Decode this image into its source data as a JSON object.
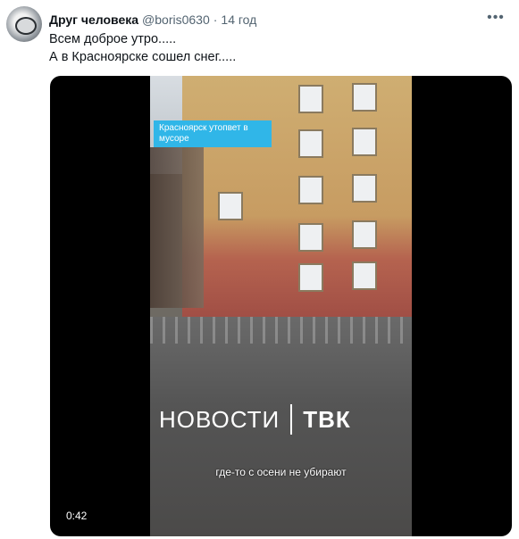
{
  "tweet": {
    "author_name": "Друг человека",
    "handle": "@boris0630",
    "separator": "·",
    "time": "14 год",
    "more_icon": "more-icon",
    "text_lines": [
      "Всем доброе утро.....",
      "А в Красноярске сошел снег....."
    ]
  },
  "video": {
    "caption_box": "Красноярск утопвет в мусоре",
    "brand_left": "НОВОСТИ",
    "brand_right": "ТВК",
    "subtitle": "где-то с осени не убирают",
    "duration": "0:42",
    "caption_color": "#30b6e8"
  }
}
